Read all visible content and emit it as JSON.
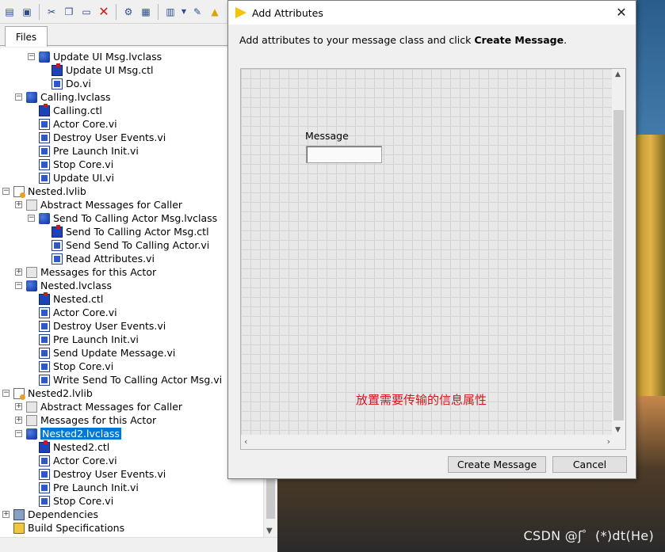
{
  "project_window": {
    "tab_files": "Files",
    "toolbar_icons": [
      "open-folder-icon",
      "save-all-icon",
      "cut-icon",
      "copy-icon",
      "paste-icon",
      "delete-icon",
      "build-icon",
      "save-icon",
      "view-icon",
      "dropdown-icon",
      "properties-icon",
      "warning-icon"
    ],
    "tree": [
      {
        "label": "Update UI Msg.lvclass",
        "type": "lvclass"
      },
      {
        "label": "Update UI Msg.ctl",
        "type": "ctl"
      },
      {
        "label": "Do.vi",
        "type": "vi"
      },
      {
        "label": "Calling.lvclass",
        "type": "lvclass"
      },
      {
        "label": "Calling.ctl",
        "type": "ctl"
      },
      {
        "label": "Actor Core.vi",
        "type": "vi"
      },
      {
        "label": "Destroy User Events.vi",
        "type": "vi"
      },
      {
        "label": "Pre Launch Init.vi",
        "type": "vi"
      },
      {
        "label": "Stop Core.vi",
        "type": "vi"
      },
      {
        "label": "Update UI.vi",
        "type": "vi"
      },
      {
        "label": "Nested.lvlib",
        "type": "lvlib"
      },
      {
        "label": "Abstract Messages for Caller",
        "type": "folder"
      },
      {
        "label": "Send To Calling Actor Msg.lvclass",
        "type": "lvclass"
      },
      {
        "label": "Send To Calling Actor Msg.ctl",
        "type": "ctl"
      },
      {
        "label": "Send Send To Calling Actor.vi",
        "type": "vi"
      },
      {
        "label": "Read Attributes.vi",
        "type": "vi"
      },
      {
        "label": "Messages for this Actor",
        "type": "folder"
      },
      {
        "label": "Nested.lvclass",
        "type": "lvclass"
      },
      {
        "label": "Nested.ctl",
        "type": "ctl"
      },
      {
        "label": "Actor Core.vi",
        "type": "vi"
      },
      {
        "label": "Destroy User Events.vi",
        "type": "vi"
      },
      {
        "label": "Pre Launch Init.vi",
        "type": "vi"
      },
      {
        "label": "Send Update Message.vi",
        "type": "vi"
      },
      {
        "label": "Stop Core.vi",
        "type": "vi"
      },
      {
        "label": "Write Send To Calling Actor Msg.vi",
        "type": "vi"
      },
      {
        "label": "Nested2.lvlib",
        "type": "lvlib"
      },
      {
        "label": "Abstract Messages for Caller",
        "type": "folder"
      },
      {
        "label": "Messages for this Actor",
        "type": "folder"
      },
      {
        "label": "Nested2.lvclass",
        "type": "lvclass",
        "selected": true
      },
      {
        "label": "Nested2.ctl",
        "type": "ctl"
      },
      {
        "label": "Actor Core.vi",
        "type": "vi"
      },
      {
        "label": "Destroy User Events.vi",
        "type": "vi"
      },
      {
        "label": "Pre Launch Init.vi",
        "type": "vi"
      },
      {
        "label": "Stop Core.vi",
        "type": "vi"
      },
      {
        "label": "Dependencies",
        "type": "deps"
      },
      {
        "label": "Build Specifications",
        "type": "build"
      }
    ]
  },
  "dialog": {
    "title": "Add Attributes",
    "instruction_prefix": "Add attributes to your message class and click ",
    "instruction_action": "Create Message",
    "instruction_suffix": ".",
    "message_label": "Message",
    "message_value": "",
    "annotation": "放置需要传输的信息属性",
    "annotation_color": "#d0161d",
    "create_button": "Create Message",
    "cancel_button": "Cancel"
  },
  "watermark": "CSDN @ʃ゜(*)dt(He)",
  "colors": {
    "selection": "#0078d7",
    "lvclass_icon": "#1a44b8"
  }
}
